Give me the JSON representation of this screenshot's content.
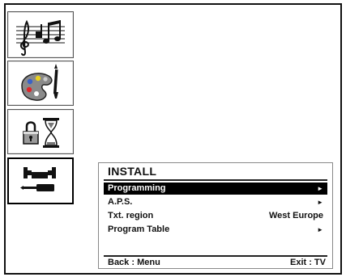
{
  "sidebar": {
    "items": [
      {
        "name": "sound",
        "icon": "music-notes-icon",
        "selected": false
      },
      {
        "name": "picture",
        "icon": "paint-palette-icon",
        "selected": false
      },
      {
        "name": "features",
        "icon": "lock-hourglass-icon",
        "selected": false
      },
      {
        "name": "install",
        "icon": "wrench-screwdriver-icon",
        "selected": true
      }
    ]
  },
  "menu": {
    "title": "INSTALL",
    "items": [
      {
        "label": "Programming",
        "value": "",
        "arrow": "►",
        "highlighted": true
      },
      {
        "label": "A.P.S.",
        "value": "",
        "arrow": "►",
        "highlighted": false
      },
      {
        "label": "Txt. region",
        "value": "West Europe",
        "arrow": "",
        "highlighted": false
      },
      {
        "label": "Program Table",
        "value": "",
        "arrow": "►",
        "highlighted": false
      }
    ],
    "footer": {
      "left": "Back : Menu",
      "right": "Exit : TV"
    }
  },
  "colors": {
    "highlight_bg": "#000000",
    "highlight_fg": "#ffffff",
    "background": "#ffffff"
  }
}
